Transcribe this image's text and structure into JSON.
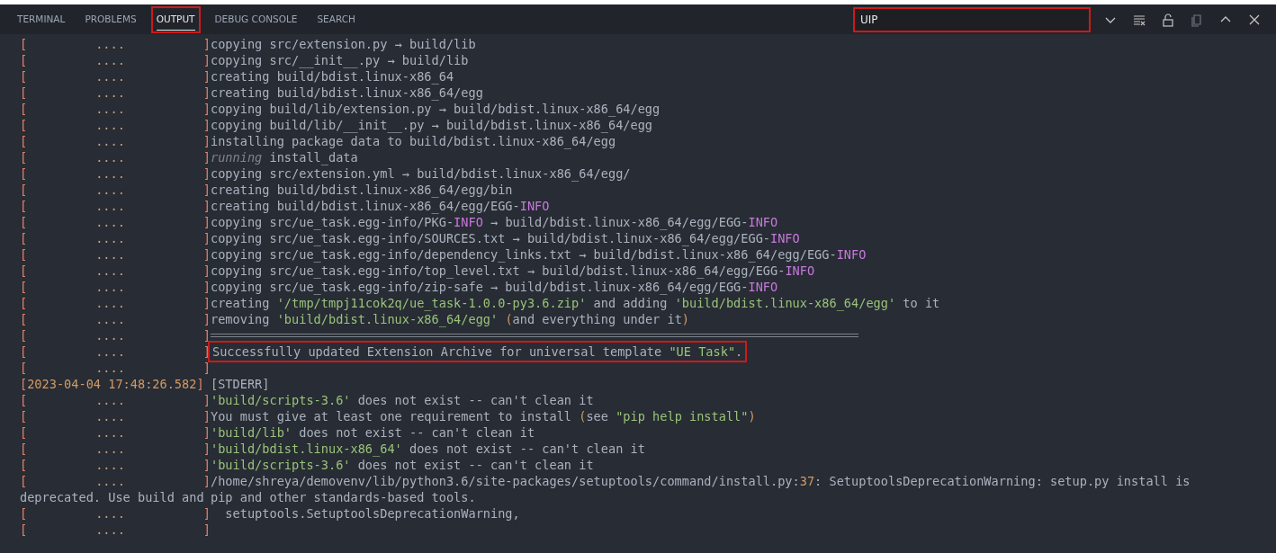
{
  "tabs": [
    {
      "label": "TERMINAL",
      "selected": false,
      "highlighted": false
    },
    {
      "label": "PROBLEMS",
      "selected": false,
      "highlighted": false
    },
    {
      "label": "OUTPUT",
      "selected": true,
      "highlighted": true
    },
    {
      "label": "DEBUG CONSOLE",
      "selected": false,
      "highlighted": false
    },
    {
      "label": "SEARCH",
      "selected": false,
      "highlighted": false
    }
  ],
  "filter": {
    "value": "UIP",
    "highlighted": true
  },
  "log": [
    {
      "kind": "log",
      "open": "[",
      "dots": "....",
      "close": "]",
      "segments": [
        {
          "kind": "text",
          "text": "copying src/extension.py → build/lib"
        }
      ]
    },
    {
      "kind": "log",
      "open": "[",
      "dots": "....",
      "close": "]",
      "segments": [
        {
          "kind": "text",
          "text": "copying src/__init__.py → build/lib"
        }
      ]
    },
    {
      "kind": "log",
      "open": "[",
      "dots": "....",
      "close": "]",
      "segments": [
        {
          "kind": "text",
          "text": "creating build/bdist.linux-x86_64"
        }
      ]
    },
    {
      "kind": "log",
      "open": "[",
      "dots": "....",
      "close": "]",
      "segments": [
        {
          "kind": "text",
          "text": "creating build/bdist.linux-x86_64/egg"
        }
      ]
    },
    {
      "kind": "log",
      "open": "[",
      "dots": "....",
      "close": "]",
      "segments": [
        {
          "kind": "text",
          "text": "copying build/lib/extension.py → build/bdist.linux-x86_64/egg"
        }
      ]
    },
    {
      "kind": "log",
      "open": "[",
      "dots": "....",
      "close": "]",
      "segments": [
        {
          "kind": "text",
          "text": "copying build/lib/__init__.py → build/bdist.linux-x86_64/egg"
        }
      ]
    },
    {
      "kind": "log",
      "open": "[",
      "dots": "....",
      "close": "]",
      "segments": [
        {
          "kind": "text",
          "text": "installing package data to build/bdist.linux-x86_64/egg"
        }
      ]
    },
    {
      "kind": "log",
      "open": "[",
      "dots": "....",
      "close": "]",
      "segments": [
        {
          "kind": "italic",
          "text": "running"
        },
        {
          "kind": "text",
          "text": " install_data"
        }
      ]
    },
    {
      "kind": "log",
      "open": "[",
      "dots": "....",
      "close": "]",
      "segments": [
        {
          "kind": "text",
          "text": "copying src/extension.yml → build/bdist.linux-x86_64/egg/"
        }
      ]
    },
    {
      "kind": "log",
      "open": "[",
      "dots": "....",
      "close": "]",
      "segments": [
        {
          "kind": "text",
          "text": "creating build/bdist.linux-x86_64/egg/bin"
        }
      ]
    },
    {
      "kind": "log",
      "open": "[",
      "dots": "....",
      "close": "]",
      "segments": [
        {
          "kind": "text",
          "text": "creating build/bdist.linux-x86_64/egg/EGG-"
        },
        {
          "kind": "keyword",
          "text": "INFO"
        }
      ]
    },
    {
      "kind": "log",
      "open": "[",
      "dots": "....",
      "close": "]",
      "segments": [
        {
          "kind": "text",
          "text": "copying src/ue_task.egg-info/PKG-"
        },
        {
          "kind": "keyword",
          "text": "INFO"
        },
        {
          "kind": "text",
          "text": " → build/bdist.linux-x86_64/egg/EGG-"
        },
        {
          "kind": "keyword",
          "text": "INFO"
        }
      ]
    },
    {
      "kind": "log",
      "open": "[",
      "dots": "....",
      "close": "]",
      "segments": [
        {
          "kind": "text",
          "text": "copying src/ue_task.egg-info/SOURCES.txt → build/bdist.linux-x86_64/egg/EGG-"
        },
        {
          "kind": "keyword",
          "text": "INFO"
        }
      ]
    },
    {
      "kind": "log",
      "open": "[",
      "dots": "....",
      "close": "]",
      "segments": [
        {
          "kind": "text",
          "text": "copying src/ue_task.egg-info/dependency_links.txt → build/bdist.linux-x86_64/egg/EGG-"
        },
        {
          "kind": "keyword",
          "text": "INFO"
        }
      ]
    },
    {
      "kind": "log",
      "open": "[",
      "dots": "....",
      "close": "]",
      "segments": [
        {
          "kind": "text",
          "text": "copying src/ue_task.egg-info/top_level.txt → build/bdist.linux-x86_64/egg/EGG-"
        },
        {
          "kind": "keyword",
          "text": "INFO"
        }
      ]
    },
    {
      "kind": "log",
      "open": "[",
      "dots": "....",
      "close": "]",
      "segments": [
        {
          "kind": "text",
          "text": "copying src/ue_task.egg-info/zip-safe → build/bdist.linux-x86_64/egg/EGG-"
        },
        {
          "kind": "keyword",
          "text": "INFO"
        }
      ]
    },
    {
      "kind": "log",
      "open": "[",
      "dots": "....",
      "close": "]",
      "segments": [
        {
          "kind": "text",
          "text": "creating "
        },
        {
          "kind": "string",
          "text": "'/tmp/tmpj11cok2q/ue_task-1.0.0-py3.6.zip'"
        },
        {
          "kind": "text",
          "text": " and adding "
        },
        {
          "kind": "string",
          "text": "'build/bdist.linux-x86_64/egg'"
        },
        {
          "kind": "text",
          "text": " to it"
        }
      ]
    },
    {
      "kind": "log",
      "open": "[",
      "dots": "....",
      "close": "]",
      "segments": [
        {
          "kind": "text",
          "text": "removing "
        },
        {
          "kind": "string",
          "text": "'build/bdist.linux-x86_64/egg'"
        },
        {
          "kind": "number",
          "text": " ("
        },
        {
          "kind": "text",
          "text": "and everything under it"
        },
        {
          "kind": "number",
          "text": ")"
        }
      ]
    },
    {
      "kind": "rule",
      "open": "[",
      "dots": "....",
      "close": "]"
    },
    {
      "kind": "log",
      "open": "[",
      "dots": "....",
      "close": "]",
      "highlighted": true,
      "segments": [
        {
          "kind": "text",
          "text": "Successfully updated Extension Archive for universal template "
        },
        {
          "kind": "string",
          "text": "\"UE Task\""
        },
        {
          "kind": "text",
          "text": "."
        }
      ]
    },
    {
      "kind": "log",
      "open": "[",
      "dots": "....",
      "close": "]"
    },
    {
      "kind": "timestamp",
      "open": "[",
      "timestamp": "2023-04-04 17:48:26.582",
      "close": "]",
      "segments": [
        {
          "kind": "text",
          "text": "[STDERR]"
        }
      ]
    },
    {
      "kind": "log",
      "open": "[",
      "dots": "....",
      "close": "]",
      "segments": [
        {
          "kind": "string",
          "text": "'build/scripts-3.6'"
        },
        {
          "kind": "text",
          "text": " does not exist -- can't clean it"
        }
      ]
    },
    {
      "kind": "log",
      "open": "[",
      "dots": "....",
      "close": "]",
      "segments": [
        {
          "kind": "text",
          "text": "You must give at least one requirement to install "
        },
        {
          "kind": "number",
          "text": "("
        },
        {
          "kind": "text",
          "text": "see "
        },
        {
          "kind": "string",
          "text": "\"pip help install\""
        },
        {
          "kind": "number",
          "text": ")"
        }
      ]
    },
    {
      "kind": "log",
      "open": "[",
      "dots": "....",
      "close": "]",
      "segments": [
        {
          "kind": "string",
          "text": "'build/lib'"
        },
        {
          "kind": "text",
          "text": " does not exist -- can't clean it"
        }
      ]
    },
    {
      "kind": "log",
      "open": "[",
      "dots": "....",
      "close": "]",
      "segments": [
        {
          "kind": "string",
          "text": "'build/bdist.linux-x86_64'"
        },
        {
          "kind": "text",
          "text": " does not exist -- can't clean it"
        }
      ]
    },
    {
      "kind": "log",
      "open": "[",
      "dots": "....",
      "close": "]",
      "segments": [
        {
          "kind": "string",
          "text": "'build/scripts-3.6'"
        },
        {
          "kind": "text",
          "text": " does not exist -- can't clean it"
        }
      ]
    },
    {
      "kind": "log",
      "open": "[",
      "dots": "....",
      "close": "]",
      "segments": [
        {
          "kind": "text",
          "text": "/home/shreya/demovenv/lib/python3.6/site-packages/setuptools/command/install.py:"
        },
        {
          "kind": "number",
          "text": "37"
        },
        {
          "kind": "text",
          "text": ": SetuptoolsDeprecationWarning: setup.py install is"
        }
      ]
    },
    {
      "kind": "wrap",
      "prefix_text": "deprecated. Use build and",
      "segments": [
        {
          "kind": "text",
          "text": "pip and other standards-based tools."
        }
      ]
    },
    {
      "kind": "log",
      "open": "[",
      "dots": "....",
      "close": "]",
      "segments": [
        {
          "kind": "text",
          "text": "  setuptools.SetuptoolsDeprecationWarning,"
        }
      ]
    },
    {
      "kind": "log",
      "open": "[",
      "dots": "....",
      "close": "]"
    }
  ]
}
